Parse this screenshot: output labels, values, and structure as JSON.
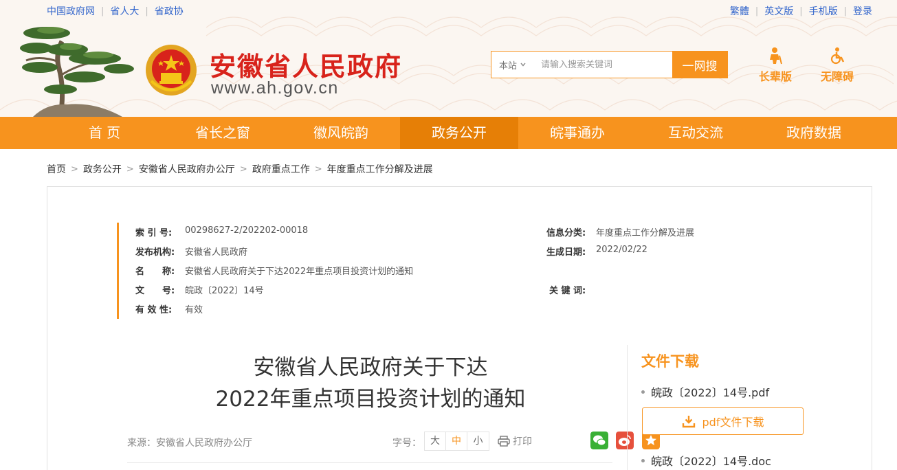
{
  "top_links_left": [
    "中国政府网",
    "省人大",
    "省政协"
  ],
  "top_links_right": [
    "繁體",
    "英文版",
    "手机版",
    "登录"
  ],
  "site": {
    "title": "安徽省人民政府",
    "url": "www.ah.gov.cn"
  },
  "search": {
    "scope": "本站",
    "placeholder": "请输入搜索关键词",
    "button": "一网搜"
  },
  "modes": {
    "elder": "长辈版",
    "accessible": "无障碍"
  },
  "nav": {
    "items": [
      "首 页",
      "省长之窗",
      "徽风皖韵",
      "政务公开",
      "皖事通办",
      "互动交流",
      "政府数据"
    ],
    "active": "政务公开"
  },
  "breadcrumb": [
    "首页",
    "政务公开",
    "安徽省人民政府办公厅",
    "政府重点工作",
    "年度重点工作分解及进展"
  ],
  "meta": {
    "index_label": "索 引 号:",
    "index_value": "00298627-2/202202-00018",
    "category_label": "信息分类:",
    "category_value": "年度重点工作分解及进展",
    "publisher_label": "发布机构:",
    "publisher_value": "安徽省人民政府",
    "date_label": "生成日期:",
    "date_value": "2022/02/22",
    "name_label": "名　　称:",
    "name_value": "安徽省人民政府关于下达2022年重点项目投资计划的通知",
    "docno_label": "文　　号:",
    "docno_value": "皖政〔2022〕14号",
    "keywords_label": "关 键 词:",
    "keywords_value": "",
    "validity_label": "有 效 性:",
    "validity_value": "有效"
  },
  "document": {
    "title_line1": "安徽省人民政府关于下达",
    "title_line2": "2022年重点项目投资计划的通知",
    "source": "来源：安徽省人民政府办公厅",
    "font_size_label": "字号：",
    "font_sizes": [
      "大",
      "中",
      "小"
    ],
    "font_size_active": "中",
    "print": "打印"
  },
  "downloads": {
    "title": "文件下载",
    "pdf_name": "皖政〔2022〕14号.pdf",
    "pdf_button": "pdf文件下载",
    "doc_name": "皖政〔2022〕14号.doc"
  },
  "colors": {
    "accent": "#f7931e",
    "title_red": "#d8231b",
    "link_blue": "#3366cc",
    "wechat": "#39b035",
    "weibo": "#e6503c",
    "favorite": "#f7931e"
  }
}
